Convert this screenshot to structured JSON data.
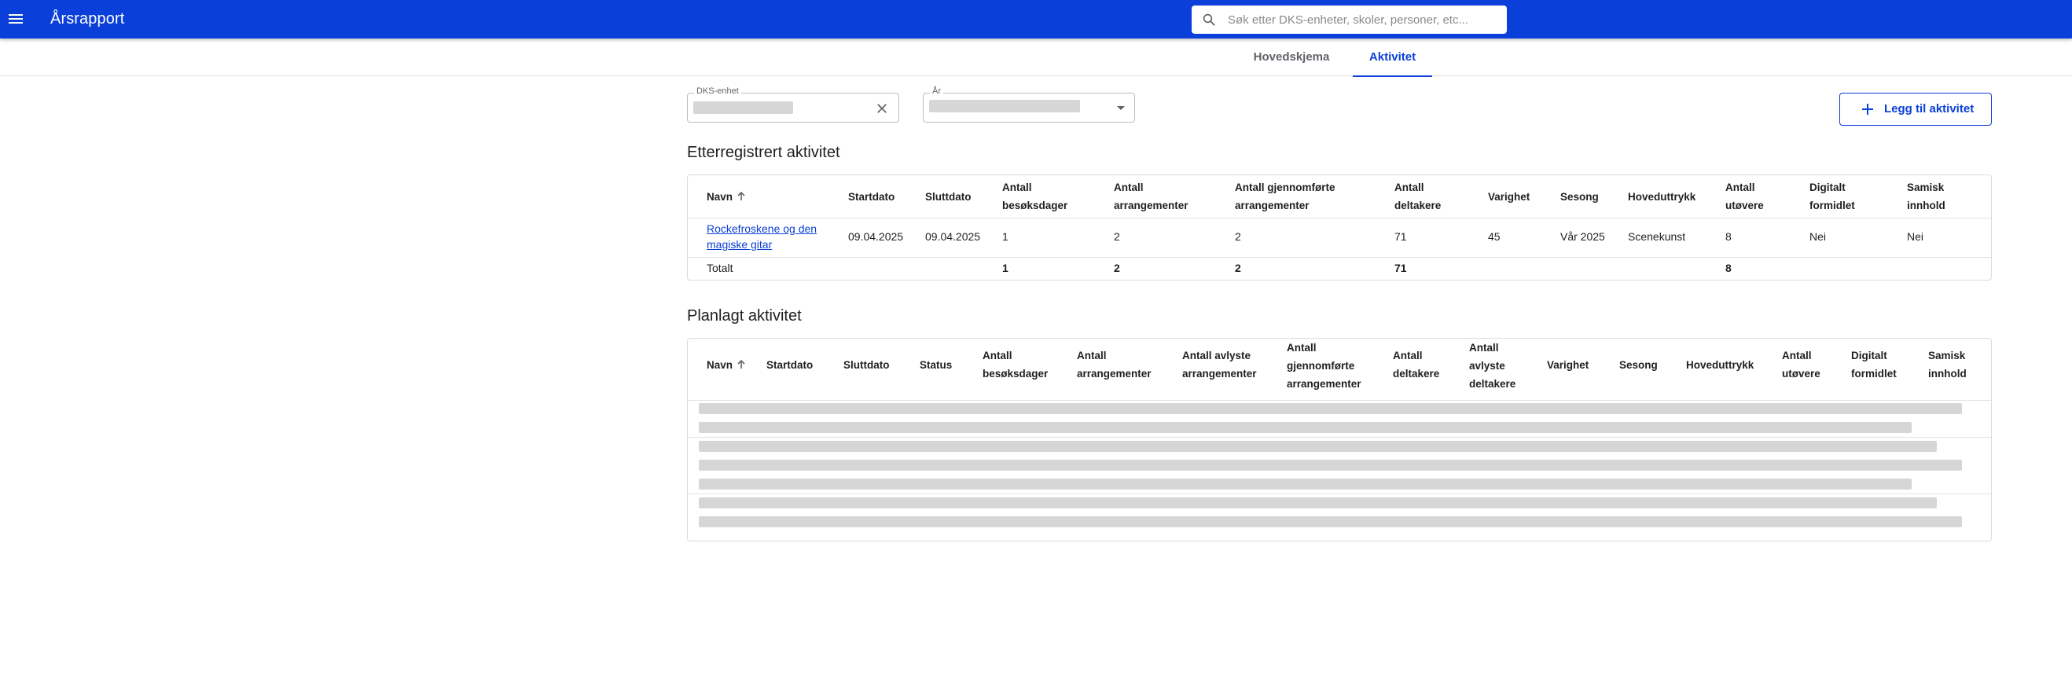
{
  "app": {
    "title": "Årsrapport",
    "search_placeholder": "Søk etter DKS-enheter, skoler, personer, etc..."
  },
  "tabs": [
    {
      "label": "Hovedskjema",
      "active": false
    },
    {
      "label": "Aktivitet",
      "active": true
    }
  ],
  "filters": {
    "dks_label": "DKS-enhet",
    "year_label": "År"
  },
  "add_button_label": "Legg til aktivitet",
  "registered": {
    "title": "Etterregistrert aktivitet",
    "headers": {
      "name": "Navn",
      "start": "Startdato",
      "end": "Sluttdato",
      "visit_days_1": "Antall",
      "visit_days_2": "besøksdager",
      "events_1": "Antall",
      "events_2": "arrangementer",
      "completed_1": "Antall gjennomførte",
      "completed_2": "arrangementer",
      "participants_1": "Antall",
      "participants_2": "deltakere",
      "duration": "Varighet",
      "season": "Sesong",
      "expression": "Hoveduttrykk",
      "performers_1": "Antall",
      "performers_2": "utøvere",
      "digital_1": "Digitalt",
      "digital_2": "formidlet",
      "sami_1": "Samisk",
      "sami_2": "innhold"
    },
    "rows": [
      {
        "name_1": "Rockefroskene og den",
        "name_2": "magiske gitar",
        "start": "09.04.2025",
        "end": "09.04.2025",
        "visit_days": "1",
        "events": "2",
        "completed": "2",
        "participants": "71",
        "duration": "45",
        "season": "Vår 2025",
        "expression": "Scenekunst",
        "performers": "8",
        "digital": "Nei",
        "sami": "Nei"
      }
    ],
    "totals": {
      "label": "Totalt",
      "visit_days": "1",
      "events": "2",
      "completed": "2",
      "participants": "71",
      "performers": "8"
    }
  },
  "planned": {
    "title": "Planlagt aktivitet",
    "headers": {
      "name": "Navn",
      "start": "Startdato",
      "end": "Sluttdato",
      "status": "Status",
      "visit_days_1": "Antall",
      "visit_days_2": "besøksdager",
      "events_1": "Antall",
      "events_2": "arrangementer",
      "cancelled_1": "Antall avlyste",
      "cancelled_2": "arrangementer",
      "completed_1": "Antall",
      "completed_2": "gjennomførte",
      "completed_3": "arrangementer",
      "participants_1": "Antall",
      "participants_2": "deltakere",
      "cancelled_part_1": "Antall",
      "cancelled_part_2": "avlyste",
      "cancelled_part_3": "deltakere",
      "duration": "Varighet",
      "season": "Sesong",
      "expression": "Hoveduttrykk",
      "performers_1": "Antall",
      "performers_2": "utøvere",
      "digital_1": "Digitalt",
      "digital_2": "formidlet",
      "sami_1": "Samisk",
      "sami_2": "innhold"
    }
  }
}
